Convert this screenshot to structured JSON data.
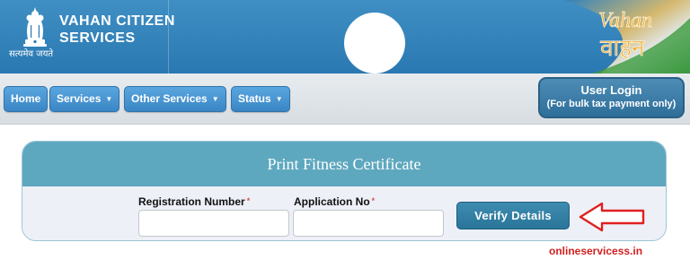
{
  "header": {
    "brand_line1": "VAHAN CITIZEN",
    "brand_line2": "SERVICES",
    "motto": "सत्यमेव जयते",
    "emblem_icon": "national-emblem-icon",
    "logo_text_en": "Vahan",
    "logo_text_hi": "वाहन",
    "colors": {
      "banner": "#2f7fb8",
      "logo_accent": "#f2b233",
      "logo_green": "#3c9a3c"
    }
  },
  "nav": {
    "items": [
      {
        "label": "Home",
        "has_dropdown": false
      },
      {
        "label": "Services",
        "has_dropdown": true
      },
      {
        "label": "Other Services",
        "has_dropdown": true
      },
      {
        "label": "Status",
        "has_dropdown": true
      }
    ],
    "caret_icon": "chevron-down-icon",
    "user_login": {
      "label": "User Login",
      "sublabel": "(For bulk tax payment only)"
    }
  },
  "form": {
    "title": "Print Fitness Certificate",
    "fields": [
      {
        "label": "Registration Number",
        "required_mark": "*",
        "value": "",
        "placeholder": ""
      },
      {
        "label": "Application No",
        "required_mark": "*",
        "value": "",
        "placeholder": ""
      }
    ],
    "submit_label": "Verify Details"
  },
  "annotation": {
    "arrow_icon": "left-arrow-icon",
    "arrow_color": "#e02020",
    "watermark": "onlineservicess.in"
  }
}
